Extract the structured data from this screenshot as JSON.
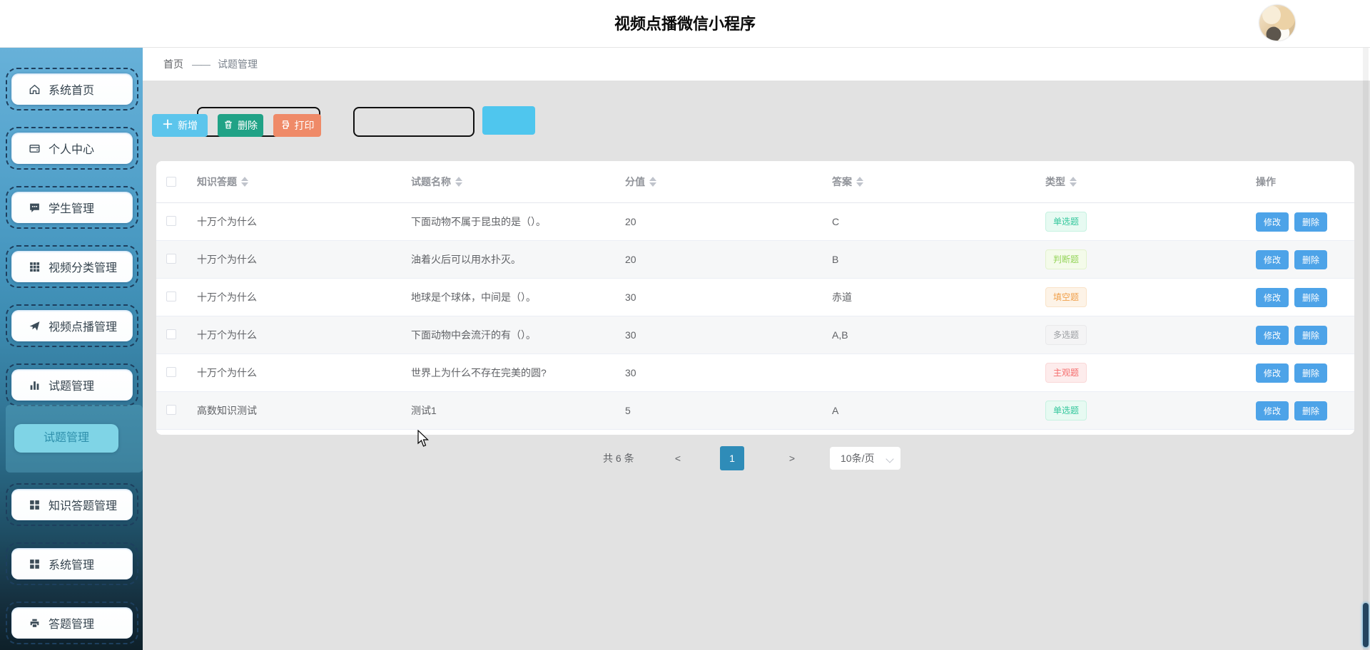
{
  "header": {
    "title": "视频点播微信小程序"
  },
  "breadcrumb": {
    "home": "首页",
    "separator": "——",
    "current": "试题管理"
  },
  "sidebar": {
    "items": [
      {
        "label": "系统首页",
        "icon": "home-icon"
      },
      {
        "label": "个人中心",
        "icon": "id-card-icon"
      },
      {
        "label": "学生管理",
        "icon": "chat-icon"
      },
      {
        "label": "视频分类管理",
        "icon": "grid-icon"
      },
      {
        "label": "视频点播管理",
        "icon": "send-icon"
      },
      {
        "label": "试题管理",
        "icon": "bar-chart-icon"
      },
      {
        "label": "知识答题管理",
        "icon": "squares-icon"
      },
      {
        "label": "系统管理",
        "icon": "squares-icon"
      },
      {
        "label": "答题管理",
        "icon": "printer-icon"
      }
    ],
    "submenu_active": "试题管理"
  },
  "toolbar": {
    "add_label": "新增",
    "delete_label": "删除",
    "print_label": "打印"
  },
  "table": {
    "columns": [
      "知识答题",
      "试题名称",
      "分值",
      "答案",
      "类型",
      "操作"
    ],
    "rows": [
      {
        "quiz": "十万个为什么",
        "name": "下面动物不属于昆虫的是（）。",
        "score": "20",
        "answer": "C",
        "type": "单选题",
        "type_class": "success"
      },
      {
        "quiz": "十万个为什么",
        "name": "油着火后可以用水扑灭。",
        "score": "20",
        "answer": "B",
        "type": "判断题",
        "type_class": "green"
      },
      {
        "quiz": "十万个为什么",
        "name": "地球是个球体，中间是（）。",
        "score": "30",
        "answer": "赤道",
        "type": "填空题",
        "type_class": "warning"
      },
      {
        "quiz": "十万个为什么",
        "name": "下面动物中会流汗的有（）。",
        "score": "30",
        "answer": "A,B",
        "type": "多选题",
        "type_class": "info"
      },
      {
        "quiz": "十万个为什么",
        "name": "世界上为什么不存在完美的圆?",
        "score": "30",
        "answer": "",
        "type": "主观题",
        "type_class": "danger"
      },
      {
        "quiz": "高数知识测试",
        "name": "测试1",
        "score": "5",
        "answer": "A",
        "type": "单选题",
        "type_class": "success"
      }
    ],
    "actions": {
      "edit": "修改",
      "delete": "删除"
    }
  },
  "pagination": {
    "total": "共 6 条",
    "prev": "<",
    "page": "1",
    "next": ">",
    "page_size": "10条/页"
  },
  "colors": {
    "sidebar_top": "#67b1d9",
    "sidebar_bottom": "#0e2029",
    "submenu_active_bg": "#7fd4e6",
    "add_button": "#5cc5ec",
    "delete_button": "#20a286",
    "print_button": "#ef8a68",
    "row_action_button": "#4da3e8",
    "active_page": "#2f8cb8",
    "search_button": "#4fc6ee",
    "tag_success": "#33c79c",
    "tag_green": "#95d45a",
    "tag_warning": "#f0a04b",
    "tag_info": "#9c9fa3",
    "tag_danger": "#f56c6c"
  }
}
